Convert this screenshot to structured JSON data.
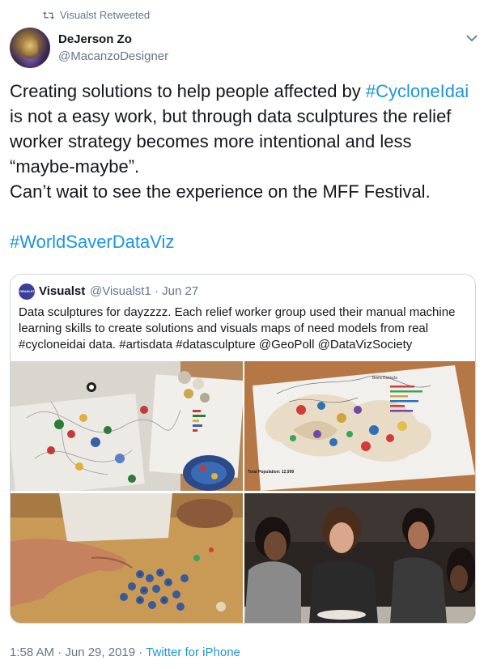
{
  "retweet": {
    "label": "Visualst Retweeted"
  },
  "author": {
    "name": "DeJerson Zo",
    "handle": "@MacanzoDesigner"
  },
  "tweet": {
    "line1_text": "Creating solutions to help people affected by ",
    "line1_hashtag": "#CycloneIdai",
    "line2": "is not a easy work, but through data sculptures the relief",
    "line3": "worker strategy becomes more intentional and less",
    "line4": "“maybe-maybe”.",
    "line5": "Can’t wait to see the experience on the MFF Festival.",
    "hashtag2": "#WorldSaverDataViz"
  },
  "quote": {
    "avatar_text": "VISUALST",
    "name": "Visualst",
    "handle_date": "@Visualst1 · Jun 27",
    "line1": "Data sculptures for dayzzzz. Each relief worker group used their manual machine",
    "line2": "learning skills to create solutions and visuals maps of need models from real",
    "line3": "#cycloneidai data. #artisdata #datasculpture @GeoPoll @DataVizSociety"
  },
  "photo2": {
    "chart_title": "Beira Districts",
    "total_label": "Total Population: 12,999"
  },
  "footer": {
    "timestamp": "1:58 AM · Jun 29, 2019 · ",
    "source": "Twitter for iPhone"
  },
  "colors": {
    "link": "#1b95e0",
    "secondary_text": "#657786",
    "border": "#ccd6dd"
  },
  "icons": {
    "retweet": "retweet-icon",
    "more": "chevron-down-icon"
  }
}
